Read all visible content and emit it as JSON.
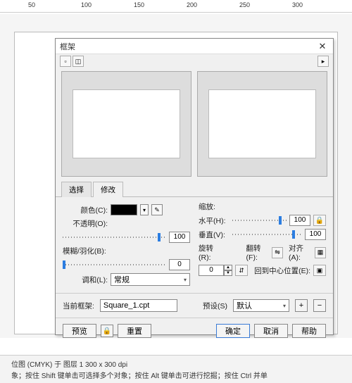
{
  "ruler": {
    "t50": "50",
    "t100": "100",
    "t150": "150",
    "t200": "200",
    "t250": "250",
    "t300": "300"
  },
  "dialog": {
    "title": "框架",
    "tabs": {
      "select": "选择",
      "modify": "修改"
    },
    "color_lbl": "颜色(C):",
    "opacity_lbl": "不透明(O):",
    "opacity_val": "100",
    "blur_lbl": "模糊/羽化(B):",
    "blur_val": "0",
    "blend_lbl": "调和(L):",
    "blend_val": "常规",
    "scale_lbl": "缩放:",
    "hscale_lbl": "水平(H):",
    "hscale_val": "100",
    "vscale_lbl": "垂直(V):",
    "vscale_val": "100",
    "rotate_lbl": "旋转(R):",
    "rotate_val": "0",
    "flip_lbl": "翻转(F):",
    "align_lbl": "对齐(A):",
    "recenter_lbl": "回到中心位置(E):",
    "current_lbl": "当前框架:",
    "current_val": "Square_1.cpt",
    "preset_lbl": "预设(S)",
    "preset_val": "默认",
    "preview_btn": "预览",
    "reset_btn": "重置",
    "ok_btn": "确定",
    "cancel_btn": "取消",
    "help_btn": "帮助"
  },
  "status": {
    "line1": "位图 (CMYK) 于 图层 1 300 x 300 dpi",
    "line2": "象；按住 Shift 键单击可选择多个对象；按住 Alt 键单击可进行挖掘；按住 Ctrl 并单"
  }
}
